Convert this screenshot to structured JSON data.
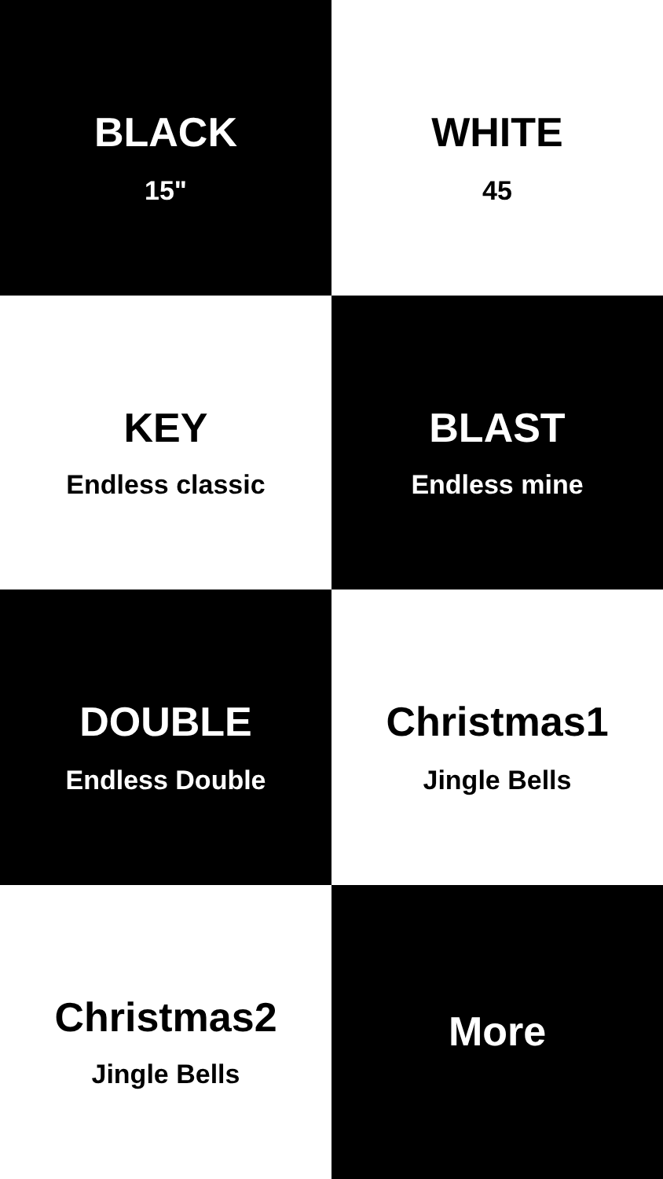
{
  "tiles": [
    {
      "title": "BLACK",
      "subtitle": "15\"",
      "color": "#000000"
    },
    {
      "title": "WHITE",
      "subtitle": "45",
      "color": "#ffffff"
    },
    {
      "title": "KEY",
      "subtitle": "Endless classic",
      "color": "#ffffff"
    },
    {
      "title": "BLAST",
      "subtitle": "Endless mine",
      "color": "#000000"
    },
    {
      "title": "DOUBLE",
      "subtitle": "Endless Double",
      "color": "#000000"
    },
    {
      "title": "Christmas1",
      "subtitle": "Jingle Bells",
      "color": "#ffffff"
    },
    {
      "title": "Christmas2",
      "subtitle": "Jingle Bells",
      "color": "#ffffff"
    },
    {
      "title": "More",
      "color": "#000000"
    }
  ]
}
